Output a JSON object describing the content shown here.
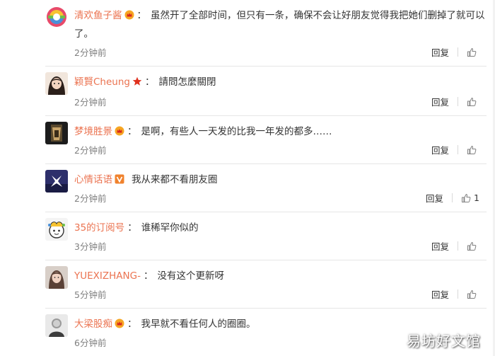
{
  "colors": {
    "username": "#eb7350",
    "text": "#333333",
    "time": "#808080",
    "divider": "#e6e6e6"
  },
  "actions": {
    "reply_label": "回复"
  },
  "comments": [
    {
      "user": "清欢鱼子酱",
      "badge": "vip-crown-icon",
      "colon": "：",
      "text": "虽然开了全部时间，但只有一条，确保不会让好朋友觉得我把她们删掉了就可以了。",
      "time": "2分钟前",
      "likes": ""
    },
    {
      "user": "颖賢Cheung",
      "badge": "red-star-icon",
      "colon": "：",
      "text": "請問怎麼關閉",
      "time": "2分钟前",
      "likes": ""
    },
    {
      "user": "梦境胜景",
      "badge": "vip-crown-icon",
      "colon": "：",
      "text": "是啊，有些人一天发的比我一年发的都多……",
      "time": "2分钟前",
      "likes": ""
    },
    {
      "user": "心情话语",
      "badge": "verified-v-icon",
      "colon": "",
      "text": "我从来都不看朋友圈",
      "time": "2分钟前",
      "likes": "1"
    },
    {
      "user": "35的订阅号",
      "badge": "",
      "colon": "：",
      "text": "谁稀罕你似的",
      "time": "3分钟前",
      "likes": ""
    },
    {
      "user": "YUEXIZHANG-",
      "badge": "",
      "colon": "：",
      "text": "没有这个更新呀",
      "time": "5分钟前",
      "likes": ""
    },
    {
      "user": "大梁股痴",
      "badge": "vip-crown-icon",
      "colon": "：",
      "text": "我早就不看任何人的圈圈。",
      "time": "6分钟前",
      "likes": ""
    }
  ],
  "watermark": "易坊好文馆"
}
